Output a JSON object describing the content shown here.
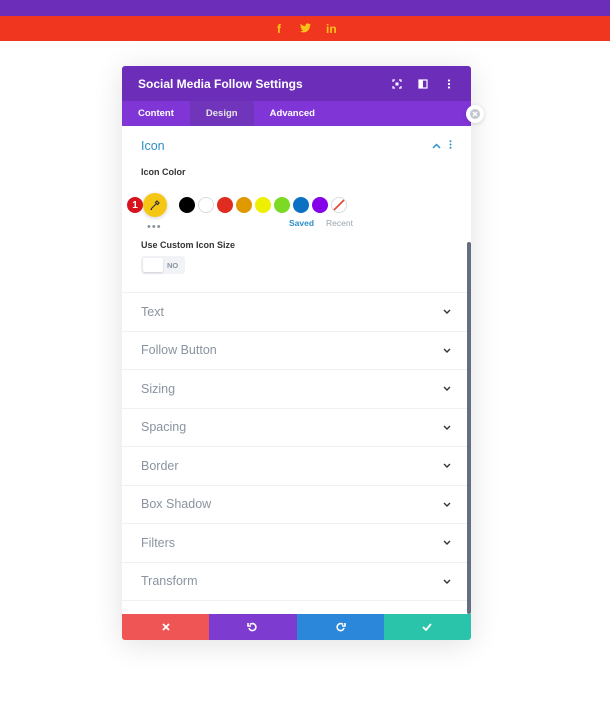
{
  "social_bar": {
    "icons": [
      {
        "name": "facebook-icon",
        "glyph": "f"
      },
      {
        "name": "twitter-icon",
        "glyph": "Ṯ"
      },
      {
        "name": "linkedin-icon",
        "glyph": "in"
      }
    ],
    "colors": {
      "top": "#6c2eb9",
      "bar": "#f0361f",
      "icon": "#f7c31a"
    }
  },
  "modal": {
    "title": "Social Media Follow Settings",
    "header_icons": [
      "fullscreen-icon",
      "split-layout-icon",
      "more-options-icon"
    ],
    "tabs": [
      {
        "label": "Content",
        "active": false
      },
      {
        "label": "Design",
        "active": true
      },
      {
        "label": "Advanced",
        "active": false
      }
    ],
    "icon_section": {
      "title": "Icon",
      "icon_color_label": "Icon Color",
      "badge": "1",
      "swatches": [
        "#000000",
        "#ffffff",
        "#e02b20",
        "#e09900",
        "#edf000",
        "#7cda24",
        "#0c71c3",
        "#8300e9"
      ],
      "saved_label": "Saved",
      "recent_label": "Recent",
      "custom_size_label": "Use Custom Icon Size",
      "toggle_value": "NO"
    },
    "sections": [
      {
        "label": "Text"
      },
      {
        "label": "Follow Button"
      },
      {
        "label": "Sizing"
      },
      {
        "label": "Spacing"
      },
      {
        "label": "Border"
      },
      {
        "label": "Box Shadow"
      },
      {
        "label": "Filters"
      },
      {
        "label": "Transform"
      }
    ],
    "footer": [
      "cancel-button",
      "undo-button",
      "redo-button",
      "save-button"
    ]
  }
}
